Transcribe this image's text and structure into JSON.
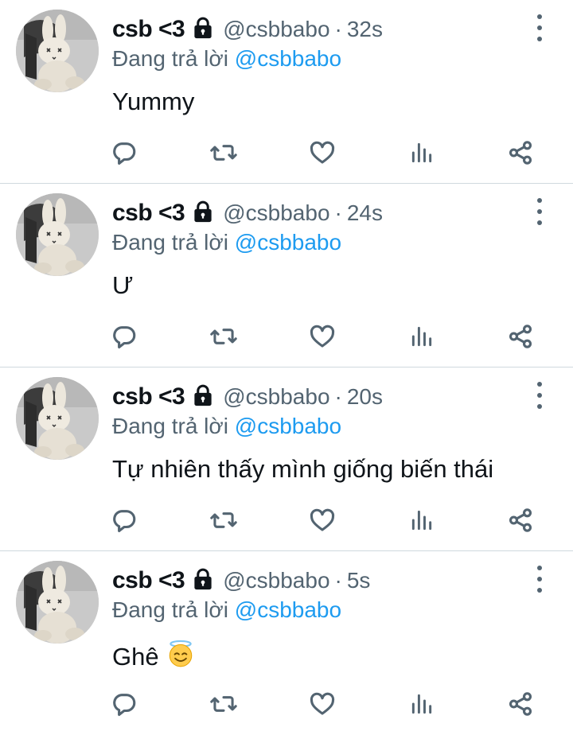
{
  "colors": {
    "accent": "#1d9bf0",
    "secondary": "#536471",
    "text": "#0f1419",
    "divider": "#cfd9de"
  },
  "tweets": [
    {
      "name": "csb <3",
      "handle": "@csbbabo",
      "time": "32s",
      "reply_prefix": "Đang trả lời",
      "reply_to": "@csbbabo",
      "text": "Yummy"
    },
    {
      "name": "csb <3",
      "handle": "@csbbabo",
      "time": "24s",
      "reply_prefix": "Đang trả lời",
      "reply_to": "@csbbabo",
      "text": "Ư"
    },
    {
      "name": "csb <3",
      "handle": "@csbbabo",
      "time": "20s",
      "reply_prefix": "Đang trả lời",
      "reply_to": "@csbbabo",
      "text": "Tự nhiên thấy mình giống biến thái"
    },
    {
      "name": "csb <3",
      "handle": "@csbbabo",
      "time": "5s",
      "reply_prefix": "Đang trả lời",
      "reply_to": "@csbbabo",
      "text": "Ghê",
      "emoji": "smiling-face-with-halo-icon"
    }
  ],
  "separator": "·",
  "action_icons": [
    "reply-icon",
    "retweet-icon",
    "like-icon",
    "views-icon",
    "share-icon"
  ]
}
